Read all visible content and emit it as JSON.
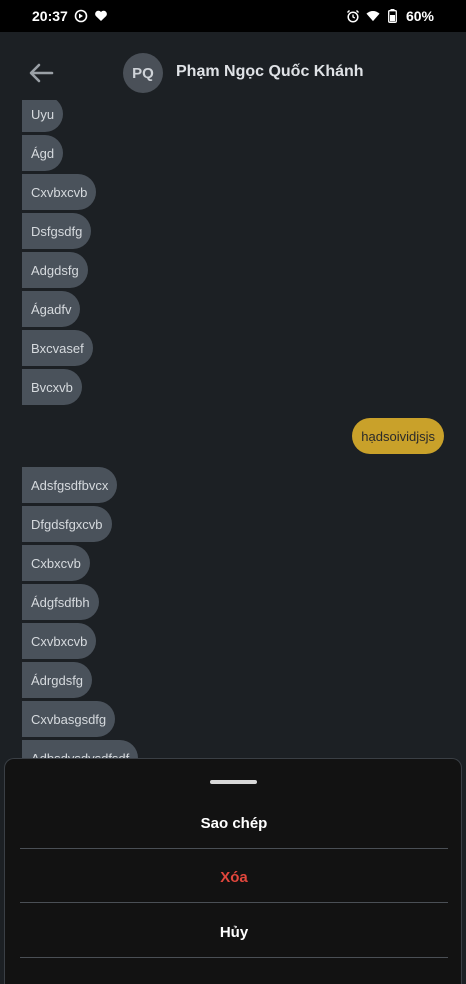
{
  "status_bar": {
    "time": "20:37",
    "battery": "60%",
    "left_icons": [
      "sync-icon",
      "heart-icon"
    ],
    "right_icons": [
      "alarm-icon",
      "wifi-icon",
      "battery-icon"
    ]
  },
  "header": {
    "avatar_initials": "PQ",
    "contact_name": "Phạm Ngọc Quốc Khánh"
  },
  "messages": [
    {
      "text": "Uyu",
      "direction": "in"
    },
    {
      "text": "Ágd",
      "direction": "in"
    },
    {
      "text": "Cxvbxcvb",
      "direction": "in"
    },
    {
      "text": "Dsfgsdfg",
      "direction": "in"
    },
    {
      "text": "Adgdsfg",
      "direction": "in"
    },
    {
      "text": "Ágadfv",
      "direction": "in"
    },
    {
      "text": "Bxcvasef",
      "direction": "in"
    },
    {
      "text": "Bvcxvb",
      "direction": "in"
    },
    {
      "text": "hạdsoividjsjs",
      "direction": "out"
    },
    {
      "text": "Adsfgsdfbvcx",
      "direction": "in"
    },
    {
      "text": "Dfgdsfgxcvb",
      "direction": "in"
    },
    {
      "text": "Cxbxcvb",
      "direction": "in"
    },
    {
      "text": "Ádgfsdfbh",
      "direction": "in"
    },
    {
      "text": "Cxvbxcvb",
      "direction": "in"
    },
    {
      "text": "Ádrgdsfg",
      "direction": "in"
    },
    {
      "text": "Cxvbasgsdfg",
      "direction": "in"
    },
    {
      "text": "Adbsdvsdvsdfsdf",
      "direction": "in"
    }
  ],
  "sheet": {
    "copy_label": "Sao chép",
    "delete_label": "Xóa",
    "cancel_label": "Hủy"
  },
  "colors": {
    "incoming_bubble": "#4a525b",
    "outgoing_bubble": "#c9a12a",
    "delete_text": "#e0463c",
    "background": "#1c2024"
  }
}
